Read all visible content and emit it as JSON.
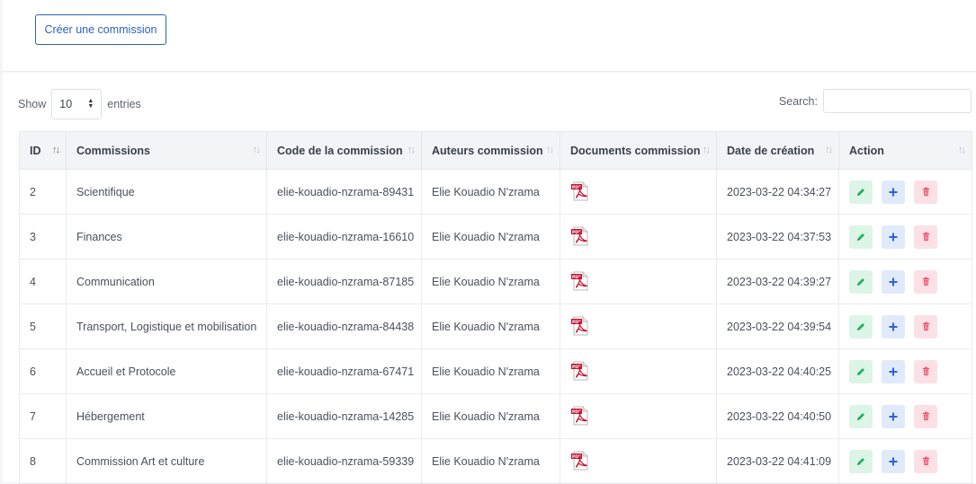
{
  "toolbar": {
    "create_label": "Créer une commission"
  },
  "table_controls": {
    "show_label": "Show",
    "page_length": "10",
    "entries_label": "entries",
    "search_label": "Search:",
    "search_value": ""
  },
  "table": {
    "headers": [
      "ID",
      "Commissions",
      "Code de la commission",
      "Auteurs commission",
      "Documents commission",
      "Date de création",
      "Action"
    ],
    "rows": [
      {
        "id": "2",
        "name": "Scientifique",
        "code": "elie-kouadio-nzrama-89431",
        "author": "Elie Kouadio N'zrama",
        "date": "2023-03-22 04:34:27"
      },
      {
        "id": "3",
        "name": "Finances",
        "code": "elie-kouadio-nzrama-16610",
        "author": "Elie Kouadio N'zrama",
        "date": "2023-03-22 04:37:53"
      },
      {
        "id": "4",
        "name": "Communication",
        "code": "elie-kouadio-nzrama-87185",
        "author": "Elie Kouadio N'zrama",
        "date": "2023-03-22 04:39:27"
      },
      {
        "id": "5",
        "name": "Transport, Logistique et mobilisation",
        "code": "elie-kouadio-nzrama-84438",
        "author": "Elie Kouadio N'zrama",
        "date": "2023-03-22 04:39:54"
      },
      {
        "id": "6",
        "name": "Accueil et Protocole",
        "code": "elie-kouadio-nzrama-67471",
        "author": "Elie Kouadio N'zrama",
        "date": "2023-03-22 04:40:25"
      },
      {
        "id": "7",
        "name": "Hébergement",
        "code": "elie-kouadio-nzrama-14285",
        "author": "Elie Kouadio N'zrama",
        "date": "2023-03-22 04:40:50"
      },
      {
        "id": "8",
        "name": "Commission Art et culture",
        "code": "elie-kouadio-nzrama-59339",
        "author": "Elie Kouadio N'zrama",
        "date": "2023-03-22 04:41:09"
      }
    ],
    "document_icon": "pdf-file-icon",
    "action_icons": [
      "pencil-icon",
      "plus-icon",
      "trash-icon"
    ]
  },
  "colors": {
    "primary": "#2c63b8",
    "edit": "#22b35e",
    "add": "#2c63d6",
    "delete": "#e8506a",
    "pdf": "#c8102e"
  }
}
